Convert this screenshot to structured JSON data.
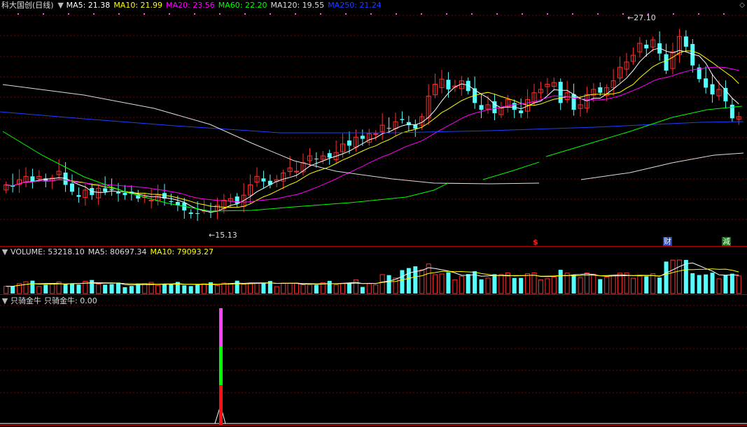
{
  "stock_title": "科大国创(日线)",
  "ma_legend": [
    {
      "label": "MA5: 21.38",
      "color": "#ffffff"
    },
    {
      "label": "MA10: 21.99",
      "color": "#ffff00"
    },
    {
      "label": "MA20: 23.56",
      "color": "#ff00ff"
    },
    {
      "label": "MA60: 22.20",
      "color": "#00ff00"
    },
    {
      "label": "MA120: 19.55",
      "color": "#dddddd"
    },
    {
      "label": "MA250: 21.24",
      "color": "#1f3fff"
    }
  ],
  "volume_legend": [
    {
      "label": "VOLUME: 53218.10",
      "color": "#dddddd"
    },
    {
      "label": "MA5: 80697.34",
      "color": "#dddddd"
    },
    {
      "label": "MA10: 79093.27",
      "color": "#ffff00"
    }
  ],
  "indicator_title": "只骑金牛",
  "indicator_value_label": "只骑金牛: 0.00",
  "high_label": "27.10",
  "low_label": "15.13",
  "event_markers": [
    {
      "text": "$",
      "color": "#ff2020"
    },
    {
      "text": "财",
      "color": "#66aaff"
    },
    {
      "text": "減",
      "color": "#44ff44"
    }
  ],
  "colors": {
    "up": "#ff3030",
    "down": "#54ffff",
    "grid": "#7a0000",
    "panel_line": "#b00000"
  },
  "icons": [
    "collapse-icon",
    "diamond-icon"
  ],
  "chart_data": {
    "type": "candlestick",
    "price_range": [
      14.4,
      28.0
    ],
    "closes": [
      17.9,
      17.8,
      18.2,
      18.4,
      18.1,
      18.4,
      18.1,
      18.3,
      18.7,
      17.9,
      17.5,
      17.2,
      17.6,
      17.3,
      17.7,
      17.5,
      17.6,
      17.4,
      17.3,
      17.4,
      17.1,
      17.2,
      17.0,
      17.3,
      17.1,
      16.9,
      16.7,
      16.4,
      16.2,
      16.2,
      16.4,
      16.3,
      16.7,
      17.0,
      17.1,
      16.8,
      17.3,
      17.9,
      18.4,
      18.1,
      17.9,
      18.2,
      18.6,
      18.9,
      18.7,
      19.2,
      19.6,
      19.4,
      19.6,
      19.5,
      19.8,
      20.3,
      20.2,
      20.7,
      20.6,
      20.9,
      20.9,
      21.4,
      21.2,
      21.6,
      21.7,
      21.4,
      21.2,
      21.9,
      23.1,
      23.8,
      24.1,
      23.5,
      23.7,
      24.0,
      23.4,
      22.7,
      22.3,
      22.6,
      22.1,
      22.4,
      22.9,
      22.3,
      22.1,
      22.9,
      23.3,
      23.5,
      23.8,
      23.9,
      22.7,
      23.3,
      22.3,
      22.6,
      23.2,
      23.5,
      23.3,
      23.6,
      24.0,
      24.8,
      25.1,
      25.5,
      26.2,
      25.9,
      26.4,
      25.6,
      24.6,
      25.7,
      26.6,
      26.0,
      24.9,
      24.1,
      23.6,
      23.2,
      23.5,
      22.8,
      21.8,
      21.9
    ]
  }
}
